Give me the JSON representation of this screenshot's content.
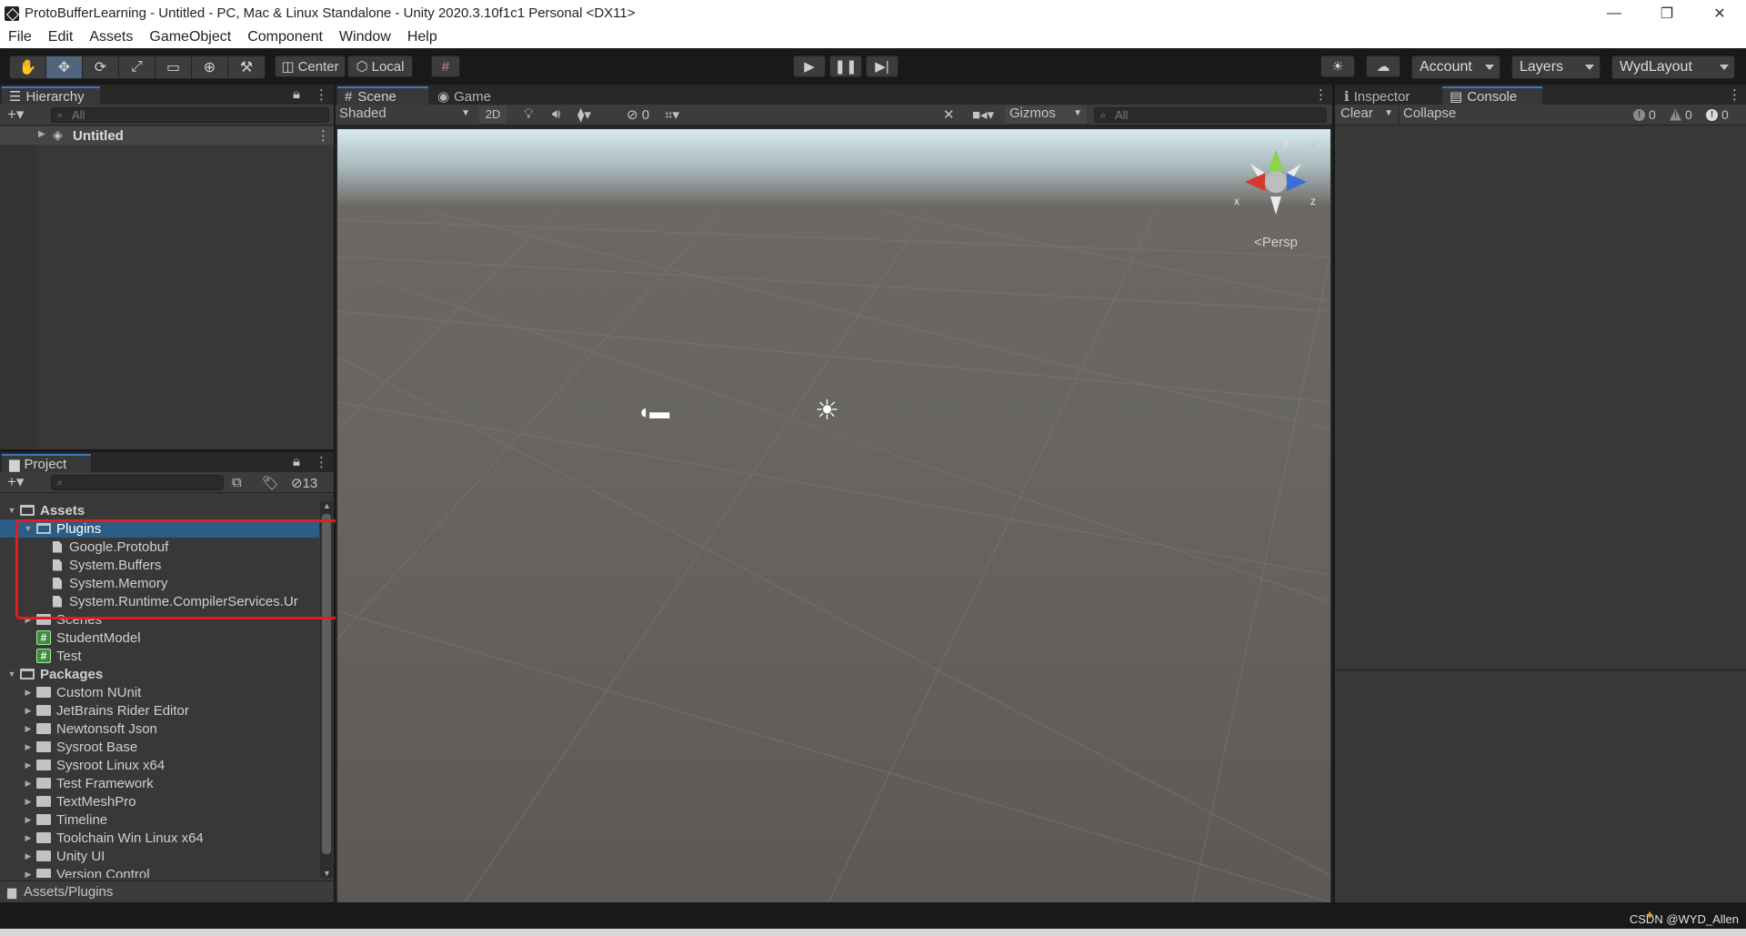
{
  "window": {
    "title": "ProtoBufferLearning - Untitled - PC, Mac & Linux Standalone - Unity 2020.3.10f1c1 Personal <DX11>",
    "minimize": "—",
    "maximize": "❐",
    "close": "✕"
  },
  "menu": [
    "File",
    "Edit",
    "Assets",
    "GameObject",
    "Component",
    "Window",
    "Help"
  ],
  "toolbar": {
    "tools": [
      "hand-icon",
      "move-icon",
      "rotate-icon",
      "scale-icon",
      "rect-icon",
      "transform-icon",
      "custom-tool-icon"
    ],
    "pivot_mode": "Center",
    "pivot_space": "Local",
    "account": "Account",
    "layers": "Layers",
    "layout": "WydLayout"
  },
  "hierarchy": {
    "tab": "Hierarchy",
    "search_placeholder": "All",
    "scene_name": "Untitled"
  },
  "project": {
    "tab": "Project",
    "hidden_count": "13",
    "breadcrumb": "Assets/Plugins",
    "tree": [
      {
        "label": "Assets",
        "depth": 0,
        "kind": "folder-open",
        "expanded": true
      },
      {
        "label": "Plugins",
        "depth": 1,
        "kind": "folder-open",
        "expanded": true,
        "selected": true
      },
      {
        "label": "Google.Protobuf",
        "depth": 2,
        "kind": "dll"
      },
      {
        "label": "System.Buffers",
        "depth": 2,
        "kind": "dll"
      },
      {
        "label": "System.Memory",
        "depth": 2,
        "kind": "dll"
      },
      {
        "label": "System.Runtime.CompilerServices.Ur",
        "depth": 2,
        "kind": "dll"
      },
      {
        "label": "Scenes",
        "depth": 1,
        "kind": "folder"
      },
      {
        "label": "StudentModel",
        "depth": 1,
        "kind": "script"
      },
      {
        "label": "Test",
        "depth": 1,
        "kind": "script"
      },
      {
        "label": "Packages",
        "depth": 0,
        "kind": "folder-open",
        "expanded": true
      },
      {
        "label": "Custom NUnit",
        "depth": 1,
        "kind": "folder"
      },
      {
        "label": "JetBrains Rider Editor",
        "depth": 1,
        "kind": "folder"
      },
      {
        "label": "Newtonsoft Json",
        "depth": 1,
        "kind": "folder"
      },
      {
        "label": "Sysroot Base",
        "depth": 1,
        "kind": "folder"
      },
      {
        "label": "Sysroot Linux x64",
        "depth": 1,
        "kind": "folder"
      },
      {
        "label": "Test Framework",
        "depth": 1,
        "kind": "folder"
      },
      {
        "label": "TextMeshPro",
        "depth": 1,
        "kind": "folder"
      },
      {
        "label": "Timeline",
        "depth": 1,
        "kind": "folder"
      },
      {
        "label": "Toolchain Win Linux x64",
        "depth": 1,
        "kind": "folder"
      },
      {
        "label": "Unity UI",
        "depth": 1,
        "kind": "folder"
      },
      {
        "label": "Version Control",
        "depth": 1,
        "kind": "folder"
      }
    ]
  },
  "scene": {
    "tab_scene": "Scene",
    "tab_game": "Game",
    "shading": "Shaded",
    "mode_2d": "2D",
    "hidden_count": "0",
    "gizmos": "Gizmos",
    "search_placeholder": "All",
    "persp_label": "Persp",
    "axis_x": "x",
    "axis_y": "y",
    "axis_z": "z"
  },
  "console": {
    "tab_inspector": "Inspector",
    "tab_console": "Console",
    "clear": "Clear",
    "collapse": "Collapse",
    "info_count": "0",
    "warn_count": "0",
    "error_count": "0"
  },
  "statusbar": {
    "watermark": "CSDN @WYD_Allen"
  }
}
